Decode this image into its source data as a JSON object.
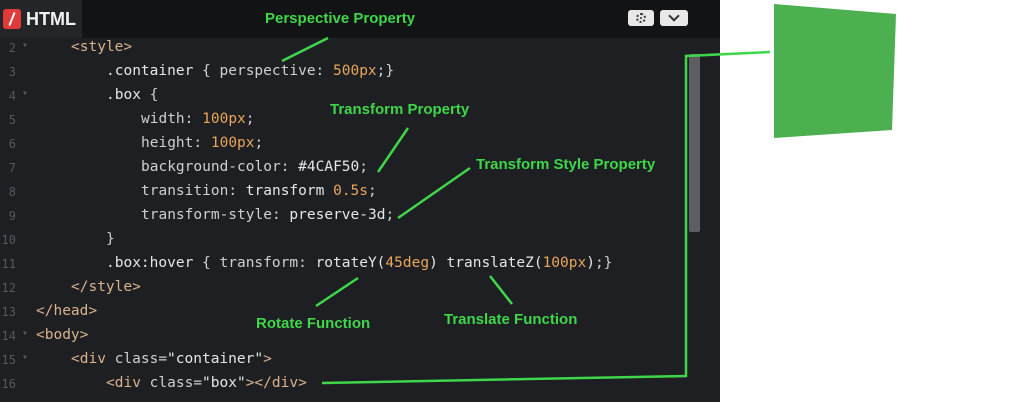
{
  "editor": {
    "tab_title": "HTML",
    "icons": {
      "logo": "html-logo-icon",
      "settings": "gear-icon",
      "collapse": "chevron-down-icon"
    },
    "accent_color": "#e03a3a"
  },
  "lines": [
    {
      "num": "2",
      "fold": true,
      "indent": 1,
      "parts": [
        [
          "tag",
          "<style>"
        ]
      ]
    },
    {
      "num": "3",
      "fold": false,
      "indent": 2,
      "parts": [
        [
          "sel",
          ".container"
        ],
        [
          "punct",
          " { "
        ],
        [
          "prop",
          "perspective"
        ],
        [
          "punct",
          ": "
        ],
        [
          "num",
          "500px"
        ],
        [
          "punct",
          ";}"
        ]
      ]
    },
    {
      "num": "4",
      "fold": true,
      "indent": 2,
      "parts": [
        [
          "sel",
          ".box"
        ],
        [
          "punct",
          " {"
        ]
      ]
    },
    {
      "num": "5",
      "fold": false,
      "indent": 3,
      "parts": [
        [
          "prop",
          "width"
        ],
        [
          "punct",
          ": "
        ],
        [
          "num",
          "100px"
        ],
        [
          "punct",
          ";"
        ]
      ]
    },
    {
      "num": "6",
      "fold": false,
      "indent": 3,
      "parts": [
        [
          "prop",
          "height"
        ],
        [
          "punct",
          ": "
        ],
        [
          "num",
          "100px"
        ],
        [
          "punct",
          ";"
        ]
      ]
    },
    {
      "num": "7",
      "fold": false,
      "indent": 3,
      "parts": [
        [
          "prop",
          "background-color"
        ],
        [
          "punct",
          ": "
        ],
        [
          "str",
          "#4CAF50"
        ],
        [
          "punct",
          ";"
        ]
      ]
    },
    {
      "num": "8",
      "fold": false,
      "indent": 3,
      "parts": [
        [
          "prop",
          "transition"
        ],
        [
          "punct",
          ": "
        ],
        [
          "str",
          "transform "
        ],
        [
          "num",
          "0.5s"
        ],
        [
          "punct",
          ";"
        ]
      ]
    },
    {
      "num": "9",
      "fold": false,
      "indent": 3,
      "parts": [
        [
          "prop",
          "transform-style"
        ],
        [
          "punct",
          ": "
        ],
        [
          "str",
          "preserve-3d"
        ],
        [
          "punct",
          ";"
        ]
      ]
    },
    {
      "num": "10",
      "fold": false,
      "indent": 2,
      "parts": [
        [
          "punct",
          "}"
        ]
      ]
    },
    {
      "num": "11",
      "fold": false,
      "indent": 2,
      "parts": [
        [
          "sel",
          ".box:hover"
        ],
        [
          "punct",
          " { "
        ],
        [
          "prop",
          "transform"
        ],
        [
          "punct",
          ": "
        ],
        [
          "fn",
          "rotateY("
        ],
        [
          "num",
          "45deg"
        ],
        [
          "fn",
          ") translateZ("
        ],
        [
          "num",
          "100px"
        ],
        [
          "fn",
          ")"
        ],
        [
          "punct",
          ";}"
        ]
      ]
    },
    {
      "num": "12",
      "fold": false,
      "indent": 1,
      "parts": [
        [
          "tag",
          "</style>"
        ]
      ]
    },
    {
      "num": "13",
      "fold": false,
      "indent": 0,
      "parts": [
        [
          "tag",
          "</head>"
        ]
      ]
    },
    {
      "num": "14",
      "fold": true,
      "indent": 0,
      "parts": [
        [
          "tag",
          "<body>"
        ]
      ]
    },
    {
      "num": "15",
      "fold": true,
      "indent": 1,
      "parts": [
        [
          "tag",
          "<div "
        ],
        [
          "prop",
          "class"
        ],
        [
          "punct",
          "="
        ],
        [
          "str",
          "\"container\""
        ],
        [
          "tag",
          ">"
        ]
      ]
    },
    {
      "num": "16",
      "fold": false,
      "indent": 2,
      "parts": [
        [
          "tag",
          "<div "
        ],
        [
          "prop",
          "class"
        ],
        [
          "punct",
          "="
        ],
        [
          "str",
          "\"box\""
        ],
        [
          "tag",
          "></div>"
        ]
      ]
    }
  ],
  "annotations": {
    "perspective": "Perspective Property",
    "transform": "Transform Property",
    "transform_style": "Transform Style Property",
    "rotate": "Rotate Function",
    "translate": "Translate Function",
    "color": "#3fd64a"
  },
  "preview": {
    "box_color": "#4CAF50"
  }
}
